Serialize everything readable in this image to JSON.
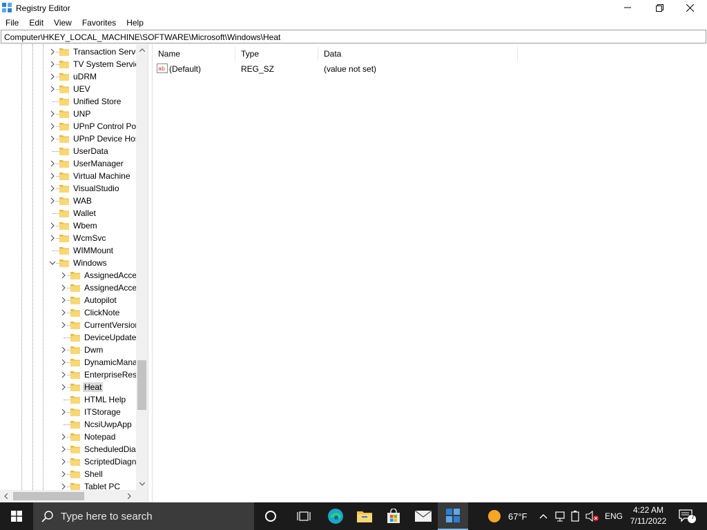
{
  "window": {
    "title": "Registry Editor"
  },
  "menu": [
    "File",
    "Edit",
    "View",
    "Favorites",
    "Help"
  ],
  "address": "Computer\\HKEY_LOCAL_MACHINE\\SOFTWARE\\Microsoft\\Windows\\Heat",
  "tree": {
    "level1": [
      "Transaction Serve",
      "TV System Servic",
      "uDRM",
      "UEV",
      "Unified Store",
      "UNP",
      "UPnP Control Poi",
      "UPnP Device Hos",
      "UserData",
      "UserManager",
      "Virtual Machine",
      "VisualStudio",
      "WAB",
      "Wallet",
      "Wbem",
      "WcmSvc",
      "WIMMount",
      "Windows"
    ],
    "level2": [
      "AssignedAcce",
      "AssignedAcce",
      "Autopilot",
      "ClickNote",
      "CurrentVersion",
      "DeviceUpdate",
      "Dwm",
      "DynamicMana",
      "EnterpriseReso",
      "Heat",
      "HTML Help",
      "ITStorage",
      "NcsiUwpApp",
      "Notepad",
      "ScheduledDiag",
      "ScriptedDiagn",
      "Shell",
      "Tablet PC"
    ],
    "selected": "Heat"
  },
  "list": {
    "columns": [
      "Name",
      "Type",
      "Data"
    ],
    "rows": [
      {
        "name": "(Default)",
        "type": "REG_SZ",
        "data": "(value not set)"
      }
    ]
  },
  "taskbar": {
    "search_placeholder": "Type here to search",
    "weather": "67°F",
    "language": "ENG",
    "time": "4:22 AM",
    "date": "7/11/2022",
    "notification_count": "7"
  },
  "colors": {
    "folder": "#f8d775",
    "taskbar": "#1b1b1b",
    "selection": "#d9d9d9",
    "accent": "#76b9ed"
  }
}
